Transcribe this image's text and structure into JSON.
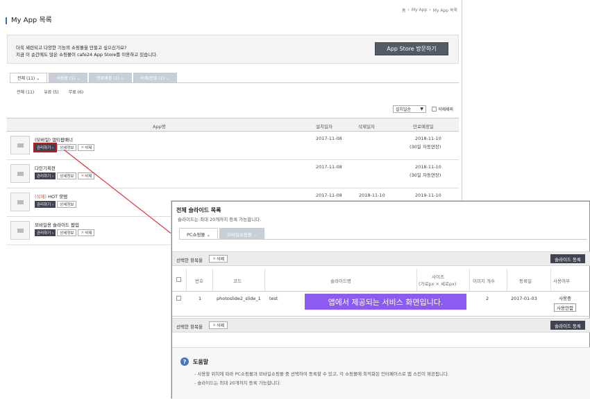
{
  "breadcrumb": [
    "홈",
    "My App",
    "My App 목록"
  ],
  "page_title": "My App 목록",
  "notice": {
    "line1": "더욱 세련되고 다양한 기능의 쇼핑몰을 만들고 싶으신가요?",
    "line2": "지금 이 순간에도 많은 쇼핑몰이 cafe24 App Store를 이용하고 있습니다.",
    "store_button": "App Store 방문하기"
  },
  "tabs": [
    "전체 (11) ⌄",
    "사용중 (5) ⌄",
    "만료예정 (1) ⌄",
    "삭제/만료 (1) ⌄"
  ],
  "subfilters": [
    "전체 (11)",
    "유료 (5)",
    "무료 (6)"
  ],
  "sort": {
    "value": "설치일순",
    "arrow": "▼"
  },
  "show_deleted": "삭제제외",
  "app_table": {
    "headers": {
      "app": "App명",
      "installed": "설치일자",
      "deleted": "삭제일자",
      "expiry": "만료예정일"
    },
    "manage_label": "관리하기 ›",
    "detail_label": "상세정보",
    "delete_label": "삭제",
    "rows": [
      {
        "tag": "",
        "name": "(모바일) 멀티팝배너",
        "installed": "2017-11-08",
        "deleted": "",
        "expiry": "2018-11-10",
        "expiry_note": "(30일 자동연장)",
        "has_delete": true
      },
      {
        "tag": "",
        "name": "다인기획전",
        "installed": "2017-11-08",
        "deleted": "",
        "expiry": "2018-11-10",
        "expiry_note": "(30일 자동연장)",
        "has_delete": true
      },
      {
        "tag": "(삭제)",
        "name": " HOT 핫템",
        "installed": "2017-11-08",
        "deleted": "2018-11-10",
        "expiry": "2019-11-10",
        "expiry_note": "",
        "has_delete": false
      },
      {
        "tag": "",
        "name": "모바일용 슬라이드 팝업",
        "installed": "",
        "deleted": "",
        "expiry": "",
        "expiry_note": "",
        "has_delete": true
      }
    ]
  },
  "slide_panel": {
    "title": "전체 슬라이드 목록",
    "subtitle": "슬라이드는 최대 20개까지 등록 가능합니다.",
    "tabs": [
      "PC쇼핑몰 ⌄",
      "모바일쇼핑몰 ⌄"
    ],
    "selected_label": "선택한 항목을",
    "delete_label": "삭제",
    "register_label": "슬라이드 등록",
    "headers": {
      "no": "번호",
      "code": "코드",
      "name": "슬라이드명",
      "size": "사이즈",
      "size_note": "(가로px × 세로px)",
      "images": "이미지 개수",
      "date": "등록일",
      "use": "사용여부"
    },
    "row": {
      "no": "1",
      "code": "photoslide2_slide_1",
      "name": "test",
      "images": "2",
      "date": "2017-01-03",
      "status": "사용중",
      "action": "사용안함"
    },
    "overlay_text": "앱에서 제공되는 서비스 화면입니다.",
    "help": {
      "title": "도움말",
      "line1": "- 사용할 위치에 따라 PC쇼핑몰과 모바일쇼핑몰 중 선택하여 등록할 수 있고, 각 쇼핑몰에 최적화된 인터페이스로 앱 스킨이 제공됩니다.",
      "line2": "- 슬라이드는 최대 20개까지 등록 가능합니다."
    }
  },
  "colors": {
    "accent_red": "#c5161e",
    "overlay_purple": "#8c5cf2",
    "dark_button": "#3f4450"
  }
}
